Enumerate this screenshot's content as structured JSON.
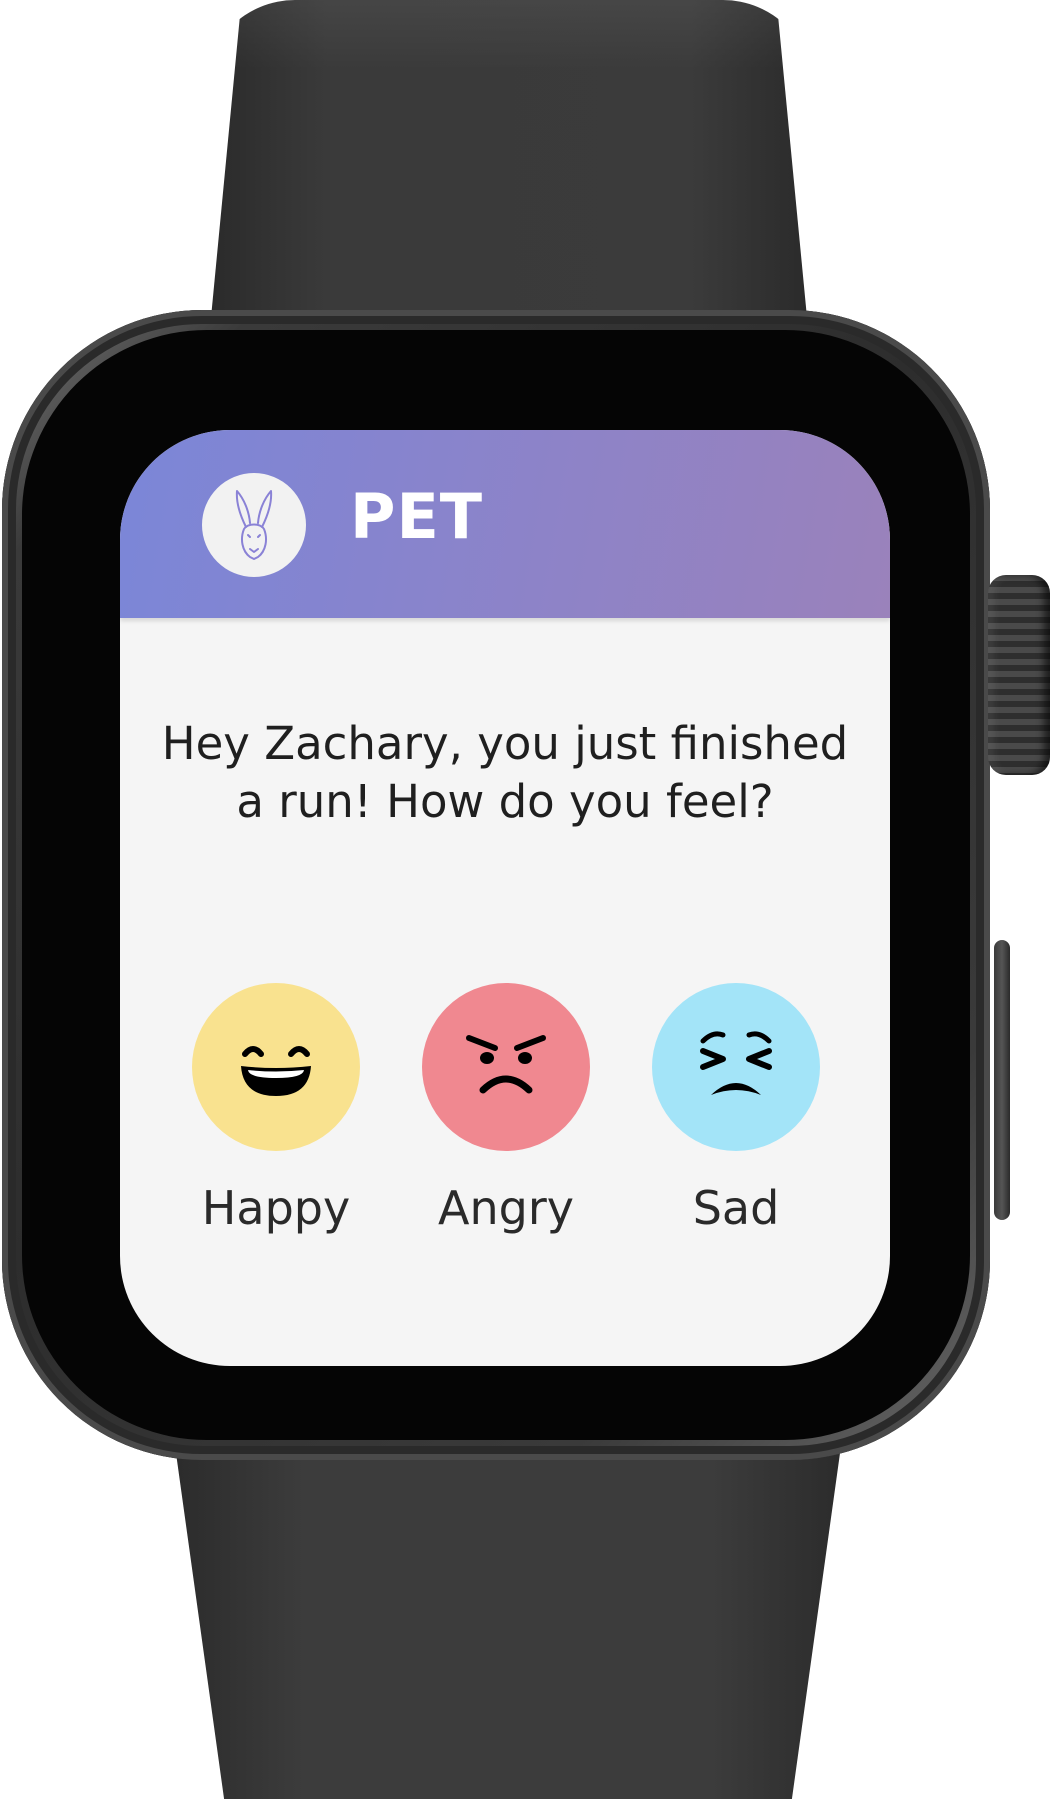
{
  "app": {
    "title": "PET",
    "icon": "rabbit-icon"
  },
  "prompt": {
    "text": "Hey Zachary, you just finished a run! How do you feel?"
  },
  "moods": [
    {
      "label": "Happy",
      "icon": "grinning-face-icon",
      "color": "#f9e28f"
    },
    {
      "label": "Angry",
      "icon": "angry-face-icon",
      "color": "#f08890"
    },
    {
      "label": "Sad",
      "icon": "persevering-face-icon",
      "color": "#a3e4f8"
    }
  ],
  "colors": {
    "header_start": "#7b86d8",
    "header_end": "#9a82bb",
    "screen_background": "#f5f5f5"
  }
}
